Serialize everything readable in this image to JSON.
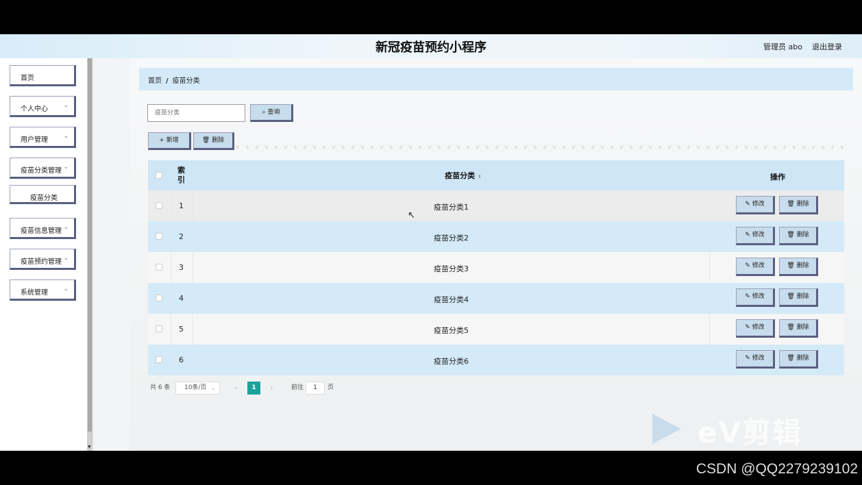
{
  "header": {
    "title": "新冠疫苗预约小程序",
    "user": "管理员 abo",
    "logout": "退出登录"
  },
  "sidebar": {
    "items": [
      {
        "label": "首页"
      },
      {
        "label": "个人中心",
        "chevron": "⌄"
      },
      {
        "label": "用户管理",
        "chevron": "⌄"
      },
      {
        "label": "疫苗分类管理",
        "chevron": "⌄"
      },
      {
        "label": "疫苗分类"
      },
      {
        "label": "疫苗信息管理",
        "chevron": "⌄"
      },
      {
        "label": "疫苗预约管理",
        "chevron": "⌄"
      },
      {
        "label": "系统管理",
        "chevron": "⌄"
      }
    ]
  },
  "breadcrumb": {
    "home": "首页",
    "sep": "/",
    "current": "疫苗分类"
  },
  "search": {
    "placeholder": "疫苗分类",
    "button": "查询",
    "icon": "search-icon"
  },
  "toolbar": {
    "add": "新增",
    "delete": "删除"
  },
  "table": {
    "headers": {
      "index": "索引",
      "category": "疫苗分类",
      "sort": "⬍",
      "actions": "操作"
    },
    "rows": [
      {
        "index": "1",
        "category": "疫苗分类1"
      },
      {
        "index": "2",
        "category": "疫苗分类2"
      },
      {
        "index": "3",
        "category": "疫苗分类3"
      },
      {
        "index": "4",
        "category": "疫苗分类4"
      },
      {
        "index": "5",
        "category": "疫苗分类5"
      },
      {
        "index": "6",
        "category": "疫苗分类6"
      }
    ],
    "edit_label": "修改",
    "delete_label": "删除"
  },
  "pagination": {
    "total": "共 6 条",
    "page_size": "10条/页",
    "prev": "‹",
    "current": "1",
    "next": "›",
    "goto_label": "前往",
    "goto_value": "1",
    "goto_unit": "页"
  },
  "watermark": "eV剪辑",
  "footer_credit": "CSDN @QQ2279239102"
}
